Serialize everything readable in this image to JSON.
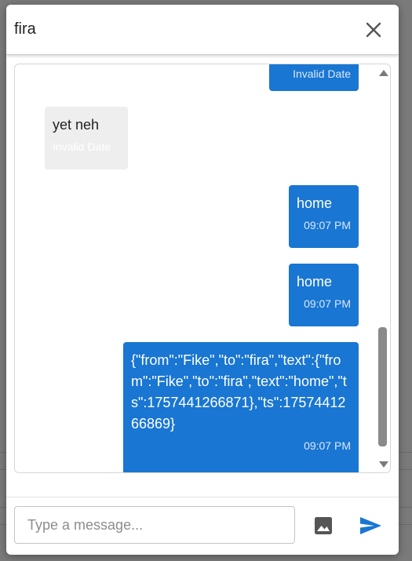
{
  "dialog": {
    "title": "fira"
  },
  "messages": [
    {
      "direction": "out",
      "text": "",
      "time": "Invalid Date"
    },
    {
      "direction": "in",
      "text": "yet neh",
      "time": "Invalid Date"
    },
    {
      "direction": "out",
      "text": "home",
      "time": "09:07 PM"
    },
    {
      "direction": "out",
      "text": "home",
      "time": "09:07 PM"
    },
    {
      "direction": "out",
      "text": "{\"from\":\"Fike\",\"to\":\"fira\",\"text\":{\"from\":\"Fike\",\"to\":\"fira\",\"text\":\"home\",\"ts\":1757441266871},\"ts\":1757441266869}",
      "time": "09:07 PM"
    }
  ],
  "composer": {
    "placeholder": "Type a message...",
    "value": ""
  },
  "icons": {
    "close": "close-icon",
    "image": "image-icon",
    "send": "send-icon"
  },
  "colors": {
    "outgoing_bubble": "#1976d2",
    "incoming_bubble": "#eeeeee",
    "send_icon": "#1976d2",
    "image_icon": "#555555"
  }
}
